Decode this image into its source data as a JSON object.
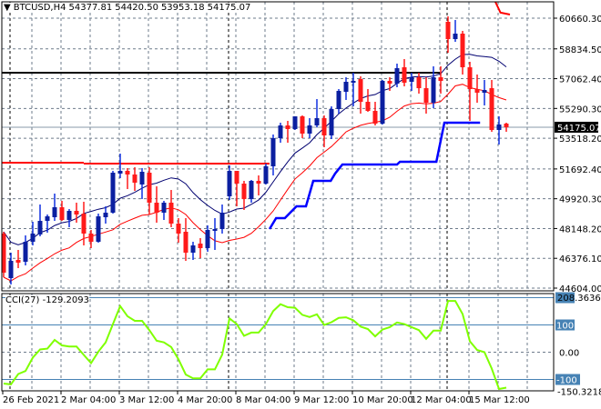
{
  "header": {
    "symbol": "BTCUSD,H4",
    "open": "54377.81",
    "high": "54420.50",
    "low": "53953.18",
    "close": "54175.07"
  },
  "colors": {
    "bull": "#0b1fa0",
    "bear": "#ff1a1a",
    "ma_fast": "#000070",
    "ma_slow": "#ff0000",
    "step_line": "#0000ff",
    "resistance": "#ff0000",
    "cci": "#7fff00",
    "grid": "#6e7b8b",
    "level": "#4682b4"
  },
  "price_axis": {
    "labels": [
      "60660.30",
      "58834.50",
      "57062.40",
      "55290.30",
      "53518.20",
      "51692.40",
      "49920.30",
      "48148.20",
      "46376.10",
      "44604.00"
    ],
    "max": 60660.3,
    "min": 44604.0,
    "current_price_label": "54175.07",
    "current_price": 54175.07
  },
  "time_axis": {
    "labels": [
      "26 Feb 2021",
      "2 Mar 04:00",
      "3 Mar 12:00",
      "4 Mar 20:00",
      "8 Mar 04:00",
      "9 Mar 12:00",
      "10 Mar 20:00",
      "12 Mar 04:00",
      "15 Mar 12:00"
    ]
  },
  "candles": [
    [
      47848,
      47956,
      45253,
      45523
    ],
    [
      45199,
      46712,
      44820,
      46226
    ],
    [
      46280,
      46875,
      45794,
      46118
    ],
    [
      46172,
      47740,
      45956,
      47361
    ],
    [
      47361,
      48550,
      47145,
      47848
    ],
    [
      47794,
      49578,
      47685,
      48604
    ],
    [
      48604,
      48983,
      47902,
      48875
    ],
    [
      48821,
      50226,
      48604,
      49415
    ],
    [
      49415,
      49794,
      48604,
      48658
    ],
    [
      48658,
      49307,
      48226,
      49199
    ],
    [
      49199,
      49686,
      48496,
      48983
    ],
    [
      49037,
      49740,
      47145,
      47848
    ],
    [
      47848,
      48064,
      46982,
      47361
    ],
    [
      47361,
      49037,
      47307,
      48875
    ],
    [
      48821,
      49470,
      48442,
      49091
    ],
    [
      49091,
      51578,
      49037,
      51470
    ],
    [
      51416,
      52605,
      51146,
      51578
    ],
    [
      51578,
      51740,
      50497,
      51362
    ],
    [
      51362,
      51794,
      50388,
      50875
    ],
    [
      50767,
      51740,
      49902,
      51524
    ],
    [
      51470,
      51794,
      48983,
      49686
    ],
    [
      49686,
      50658,
      48496,
      49091
    ],
    [
      49091,
      49794,
      48658,
      49686
    ],
    [
      49686,
      50442,
      48226,
      48442
    ],
    [
      48442,
      48767,
      47307,
      47848
    ],
    [
      47956,
      48767,
      46226,
      46712
    ],
    [
      46712,
      47361,
      46280,
      47145
    ],
    [
      47253,
      47577,
      46388,
      46982
    ],
    [
      46982,
      48334,
      46767,
      48064
    ],
    [
      48010,
      48767,
      46875,
      48118
    ],
    [
      48118,
      49578,
      47848,
      49091
    ],
    [
      50064,
      51903,
      49848,
      51578
    ],
    [
      51578,
      51578,
      49470,
      50821
    ],
    [
      50821,
      50983,
      49253,
      49902
    ],
    [
      49902,
      51037,
      49686,
      50983
    ],
    [
      50983,
      51308,
      50118,
      50821
    ],
    [
      50821,
      52010,
      50767,
      51848
    ],
    [
      51848,
      53740,
      51308,
      53524
    ],
    [
      53524,
      54443,
      53253,
      54281
    ],
    [
      54281,
      54551,
      53253,
      54065
    ],
    [
      54065,
      54821,
      54010,
      54821
    ],
    [
      54821,
      54875,
      53524,
      53794
    ],
    [
      53794,
      54713,
      53524,
      54281
    ],
    [
      54281,
      55848,
      54173,
      54713
    ],
    [
      54713,
      54875,
      52983,
      53686
    ],
    [
      53686,
      55416,
      53470,
      55254
    ],
    [
      55254,
      56443,
      54984,
      56335
    ],
    [
      56281,
      57146,
      55794,
      56876
    ],
    [
      56822,
      57416,
      55416,
      56930
    ],
    [
      57038,
      57200,
      54984,
      55686
    ],
    [
      55686,
      56443,
      55092,
      55146
    ],
    [
      55146,
      55686,
      54281,
      54389
    ],
    [
      54389,
      56984,
      54335,
      56930
    ],
    [
      56930,
      57146,
      56335,
      56767
    ],
    [
      56767,
      57957,
      56551,
      57686
    ],
    [
      57740,
      58227,
      56605,
      56822
    ],
    [
      56876,
      57416,
      56335,
      57146
    ],
    [
      57146,
      57416,
      56173,
      56497
    ],
    [
      56497,
      57146,
      54984,
      55632
    ],
    [
      55632,
      57795,
      55308,
      57146
    ],
    [
      57146,
      57795,
      56173,
      56930
    ],
    [
      60444,
      60768,
      58606,
      59416
    ],
    [
      59416,
      60552,
      59254,
      59741
    ],
    [
      59741,
      59903,
      57308,
      57740
    ],
    [
      57740,
      58065,
      54551,
      56443
    ],
    [
      56443,
      57308,
      55632,
      56227
    ],
    [
      56227,
      56984,
      55470,
      56389
    ],
    [
      56497,
      56984,
      53903,
      54011
    ],
    [
      54011,
      54821,
      53146,
      54335
    ],
    [
      54389,
      54443,
      53903,
      54175.07
    ]
  ],
  "resistance_line": {
    "segments": [
      [
        0.6,
        12.0,
        52065
      ],
      [
        12.0,
        37.5,
        52010
      ]
    ]
  },
  "resistance_top": [
    [
      68.5,
      61633
    ],
    [
      69.2,
      60990
    ],
    [
      70.5,
      60876
    ]
  ],
  "black_level": {
    "price": 57416,
    "from_bar": 0.5,
    "to_bar": 60.9
  },
  "step_line": [
    [
      37.5,
      48118
    ],
    [
      38.4,
      48767
    ],
    [
      39.6,
      48767
    ],
    [
      41.2,
      49470
    ],
    [
      42.5,
      49470
    ],
    [
      43.5,
      50983
    ],
    [
      45.9,
      50983
    ],
    [
      46.5,
      51416
    ],
    [
      47.5,
      51957
    ],
    [
      55.0,
      51957
    ],
    [
      55.4,
      52119
    ],
    [
      60.4,
      52119
    ],
    [
      61.5,
      54443
    ],
    [
      66.4,
      54443
    ]
  ],
  "cci": {
    "label": "CCI(27) -129.2093",
    "max_label": "208.3636",
    "min_label": "-150.3218",
    "max": 208.3636,
    "min": -150.3218,
    "levels": [
      {
        "value": 100,
        "label": "100"
      },
      {
        "value": -100,
        "label": "-100"
      }
    ],
    "zero_label": "0.00",
    "values": [
      -115,
      -118,
      -80,
      -69,
      -20,
      10,
      13,
      45,
      25,
      21,
      21,
      -10,
      -40,
      2,
      36,
      103,
      169,
      132,
      115,
      115,
      81,
      42,
      36,
      19,
      -26,
      -82,
      -96,
      -96,
      -63,
      -63,
      -9,
      124,
      103,
      60,
      72,
      72,
      103,
      151,
      176,
      165,
      163,
      137,
      129,
      139,
      100,
      110,
      126,
      128,
      117,
      94,
      85,
      58,
      83,
      92,
      109,
      103,
      92,
      81,
      49,
      79,
      79,
      188,
      188,
      140,
      40,
      8,
      0,
      -60,
      -135,
      -130
    ]
  }
}
